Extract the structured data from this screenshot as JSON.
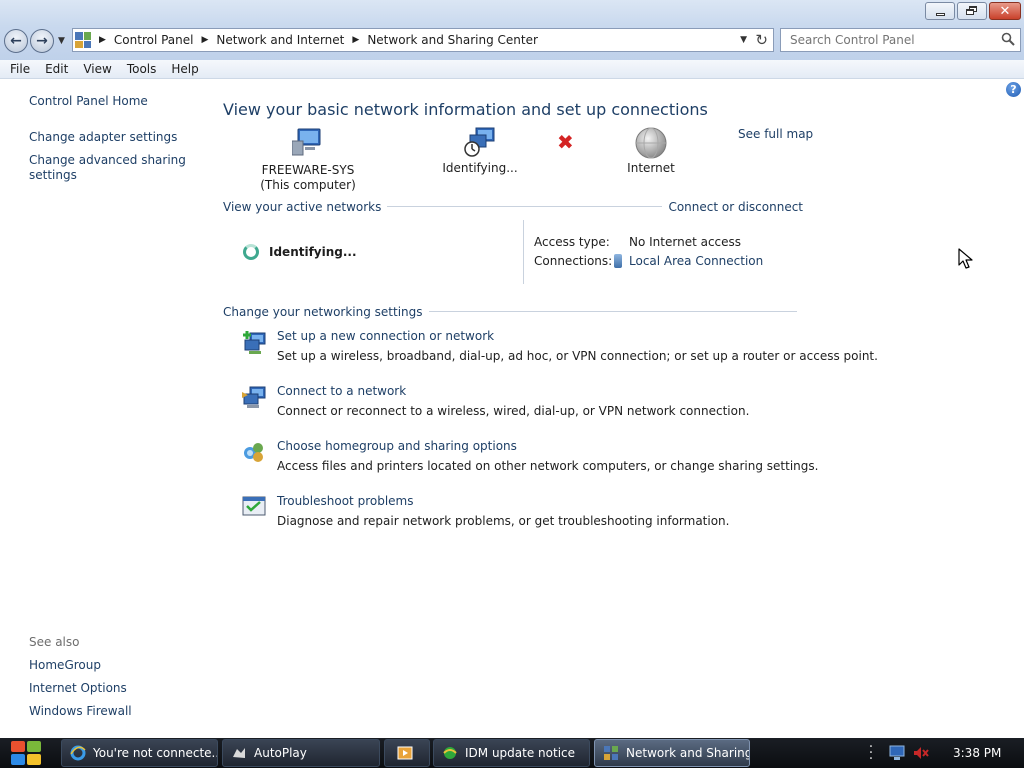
{
  "window": {
    "controls": {
      "minimize": "minimize-icon",
      "maximize": "restore-icon",
      "close": "close-icon"
    }
  },
  "nav": {
    "breadcrumbs": [
      "Control Panel",
      "Network and Internet",
      "Network and Sharing Center"
    ],
    "search_placeholder": "Search Control Panel"
  },
  "menu": [
    "File",
    "Edit",
    "View",
    "Tools",
    "Help"
  ],
  "left_pane": {
    "home": "Control Panel Home",
    "links": [
      "Change adapter settings",
      "Change advanced sharing settings"
    ],
    "see_also_title": "See also",
    "see_also": [
      "HomeGroup",
      "Internet Options",
      "Windows Firewall"
    ]
  },
  "main": {
    "title": "View your basic network information and set up connections",
    "map": {
      "computer_name": "FREEWARE-SYS",
      "computer_sub": "(This computer)",
      "network": "Identifying...",
      "internet": "Internet",
      "see_full_map": "See full map"
    },
    "active_networks": {
      "label": "View your active networks",
      "action": "Connect or disconnect",
      "network_name": "Identifying...",
      "access_type_label": "Access type:",
      "access_type_value": "No Internet access",
      "connections_label": "Connections:",
      "connections_value": "Local Area Connection"
    },
    "settings": {
      "label": "Change your networking settings",
      "tasks": [
        {
          "title": "Set up a new connection or network",
          "desc": "Set up a wireless, broadband, dial-up, ad hoc, or VPN connection; or set up a router or access point.",
          "icon": "new-connection-icon"
        },
        {
          "title": "Connect to a network",
          "desc": "Connect or reconnect to a wireless, wired, dial-up, or VPN network connection.",
          "icon": "connect-network-icon"
        },
        {
          "title": "Choose homegroup and sharing options",
          "desc": "Access files and printers located on other network computers, or change sharing settings.",
          "icon": "homegroup-icon"
        },
        {
          "title": "Troubleshoot problems",
          "desc": "Diagnose and repair network problems, or get troubleshooting information.",
          "icon": "troubleshoot-icon"
        }
      ]
    }
  },
  "taskbar": {
    "items": [
      {
        "label": "You're not connecte...",
        "icon": "ie-icon"
      },
      {
        "label": "AutoPlay",
        "icon": "autoplay-icon"
      },
      {
        "label": "",
        "icon": "media-icon"
      },
      {
        "label": "IDM update notice",
        "icon": "idm-icon"
      },
      {
        "label": "Network and Sharing...",
        "icon": "network-icon"
      }
    ],
    "clock": "3:38 PM"
  },
  "colors": {
    "link": "#1e3f66",
    "error": "#d42424",
    "taskbar": "#0b0d10"
  }
}
